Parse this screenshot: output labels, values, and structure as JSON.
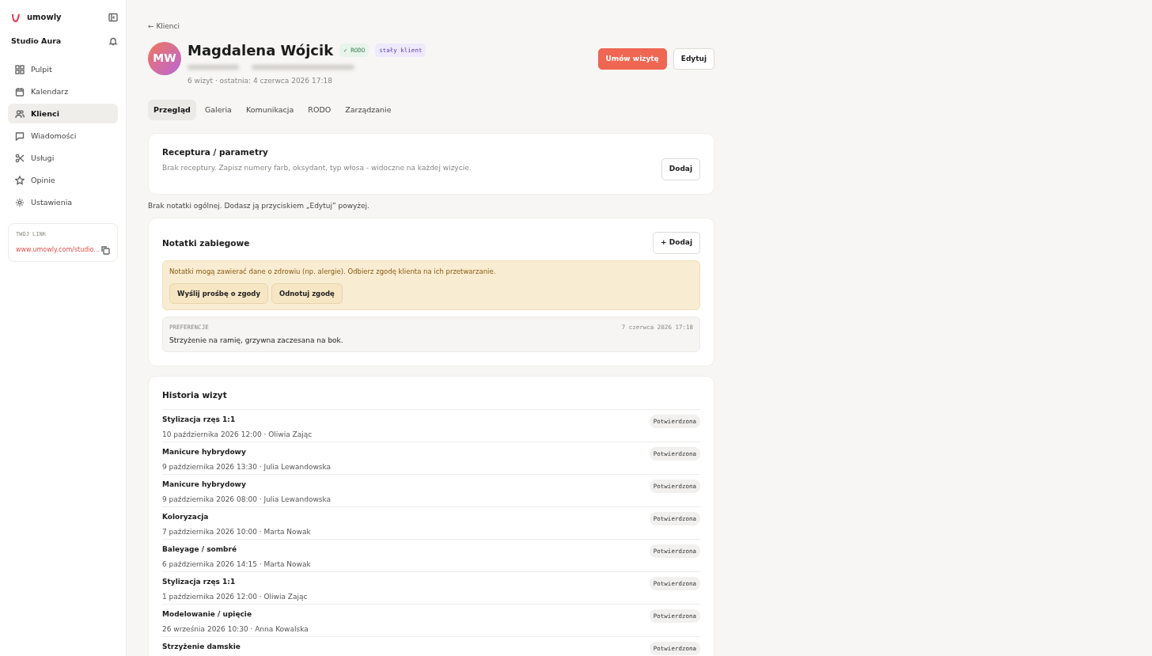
{
  "sidebar": {
    "brand": "umowly",
    "studio": "Studio Aura",
    "items": [
      {
        "label": "Pulpit",
        "selected": false
      },
      {
        "label": "Kalendarz",
        "selected": false
      },
      {
        "label": "Klienci",
        "selected": true
      },
      {
        "label": "Wiadomości",
        "selected": false
      },
      {
        "label": "Usługi",
        "selected": false
      },
      {
        "label": "Opinie",
        "selected": false
      },
      {
        "label": "Ustawienia",
        "selected": false
      }
    ],
    "link_card": {
      "label": "TWOJ LINK",
      "url": "www.umowly.com/studio..."
    }
  },
  "back_link": "← Klienci",
  "client": {
    "initials": "MW",
    "name": "Magdalena Wójcik",
    "badges": [
      {
        "text": "✓ RODO",
        "kind": "consent"
      },
      {
        "text": "stały klient",
        "kind": "tag"
      }
    ],
    "summary": "6 wizyt · ostatnia: 4 czerwca 2026 17:18"
  },
  "actions": [
    {
      "label": "Umów wizytę",
      "kind": "primary"
    },
    {
      "label": "Edytuj",
      "kind": "secondary"
    }
  ],
  "tabs": [
    {
      "label": "Przegląd",
      "selected": true
    },
    {
      "label": "Galeria",
      "selected": false
    },
    {
      "label": "Komunikacja",
      "selected": false
    },
    {
      "label": "RODO",
      "selected": false
    },
    {
      "label": "Zarządzanie",
      "selected": false
    }
  ],
  "recipe": {
    "title": "Receptura / parametry",
    "text": "Brak receptury. Zapisz numery farb, oksydant, typ włosa - widoczne na każdej wizycie.",
    "button": "Dodaj"
  },
  "general_note": "Brak notatki ogólnej. Dodasz ją przyciskiem „Edytuj” powyżej.",
  "notes": {
    "title": "Notatki zabiegowe",
    "button": "+ Dodaj",
    "warning": {
      "text": "Notatki mogą zawierać dane o zdrowiu (np. alergie). Odbierz zgodę klienta na ich przetwarzanie.",
      "buttons": [
        "Wyślij prośbę o zgody",
        "Odnotuj zgodę"
      ]
    },
    "items": [
      {
        "category": "PREFERENCJE",
        "date": "7 czerwca 2026 17:18",
        "text": "Strzyżenie na ramię, grzywna zaczesana na bok."
      }
    ]
  },
  "history": {
    "title": "Historia wizyt",
    "rows": [
      {
        "service": "Stylizacja rzęs 1:1",
        "details": "10 października 2026 12:00 · Oliwia Zając",
        "status": "Potwierdzona"
      },
      {
        "service": "Manicure hybrydowy",
        "details": "9 października 2026 13:30 · Julia Lewandowska",
        "status": "Potwierdzona"
      },
      {
        "service": "Manicure hybrydowy",
        "details": "9 października 2026 08:00 · Julia Lewandowska",
        "status": "Potwierdzona"
      },
      {
        "service": "Koloryzacja",
        "details": "7 października 2026 10:00 · Marta Nowak",
        "status": "Potwierdzona"
      },
      {
        "service": "Baleyage / sombré",
        "details": "6 października 2026 14:15 · Marta Nowak",
        "status": "Potwierdzona"
      },
      {
        "service": "Stylizacja rzęs 1:1",
        "details": "1 października 2026 12:00 · Oliwia Zając",
        "status": "Potwierdzona"
      },
      {
        "service": "Modelowanie / upięcie",
        "details": "26 września 2026 10:30 · Anna Kowalska",
        "status": "Potwierdzona"
      },
      {
        "service": "Strzyżenie damskie",
        "status": "Potwierdzona"
      }
    ]
  }
}
